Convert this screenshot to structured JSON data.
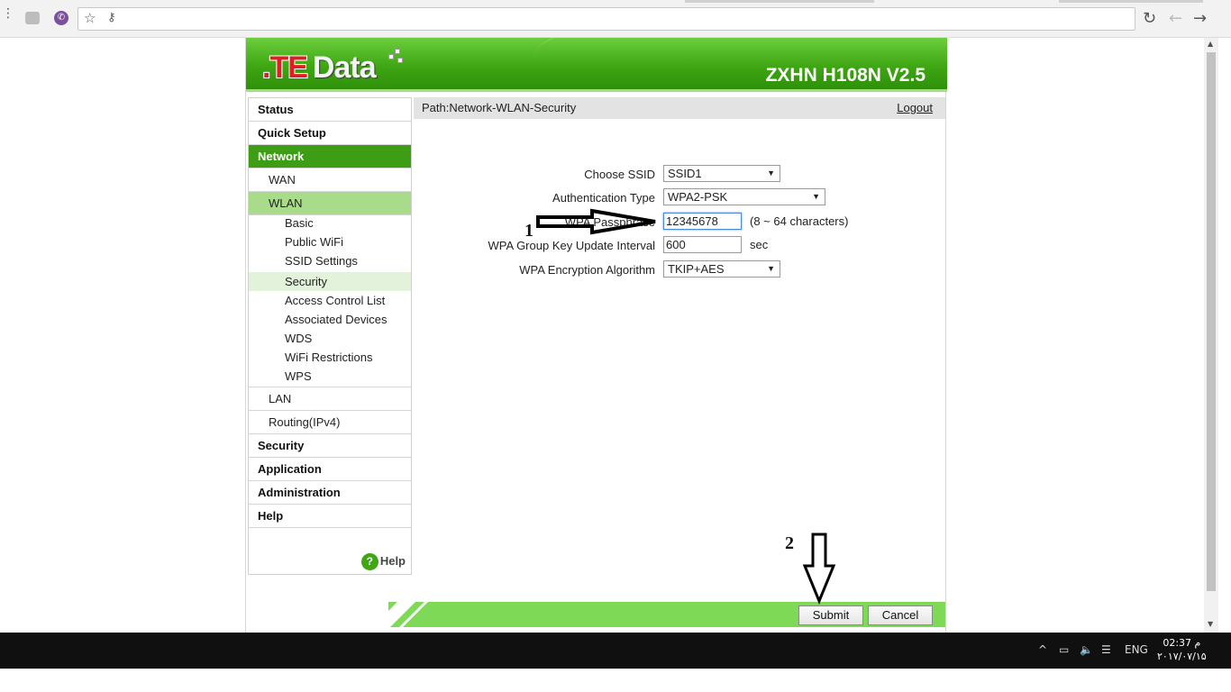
{
  "browser": {
    "ext2_icon": "viber-icon",
    "star_icon": "star-icon",
    "key_icon": "key-icon",
    "reload_icon": "reload-icon",
    "back_icon": "back-arrow-icon",
    "forward_icon": "forward-arrow-icon"
  },
  "header": {
    "logo_te": ".TE",
    "logo_data": "Data",
    "model": "ZXHN H108N V2.5"
  },
  "sidebar": {
    "items": [
      {
        "label": "Status"
      },
      {
        "label": "Quick Setup"
      },
      {
        "label": "Network"
      },
      {
        "label": "WAN"
      },
      {
        "label": "WLAN"
      },
      {
        "label": "Basic"
      },
      {
        "label": "Public WiFi"
      },
      {
        "label": "SSID Settings"
      },
      {
        "label": "Security"
      },
      {
        "label": "Access Control List"
      },
      {
        "label": "Associated Devices"
      },
      {
        "label": "WDS"
      },
      {
        "label": "WiFi Restrictions"
      },
      {
        "label": "WPS"
      },
      {
        "label": "LAN"
      },
      {
        "label": "Routing(IPv4)"
      },
      {
        "label": "Security"
      },
      {
        "label": "Application"
      },
      {
        "label": "Administration"
      },
      {
        "label": "Help"
      }
    ],
    "help_label": "Help",
    "help_glyph": "?"
  },
  "content": {
    "path": "Path:Network-WLAN-Security",
    "logout": "Logout",
    "form": {
      "ssid_label": "Choose SSID",
      "ssid_value": "SSID1",
      "auth_label": "Authentication Type",
      "auth_value": "WPA2-PSK",
      "passphrase_label": "WPA Passphrase",
      "passphrase_value": "12345678",
      "passphrase_hint": "(8 ~ 64 characters)",
      "interval_label": "WPA Group Key Update Interval",
      "interval_value": "600",
      "interval_unit": "sec",
      "encryption_label": "WPA Encryption Algorithm",
      "encryption_value": "TKIP+AES"
    },
    "submit": "Submit",
    "cancel": "Cancel"
  },
  "annotations": {
    "one": "1",
    "two": "2"
  },
  "taskbar": {
    "lang": "ENG",
    "time": "02:37 م",
    "date": "۲۰۱۷/۰۷/۱۵"
  }
}
